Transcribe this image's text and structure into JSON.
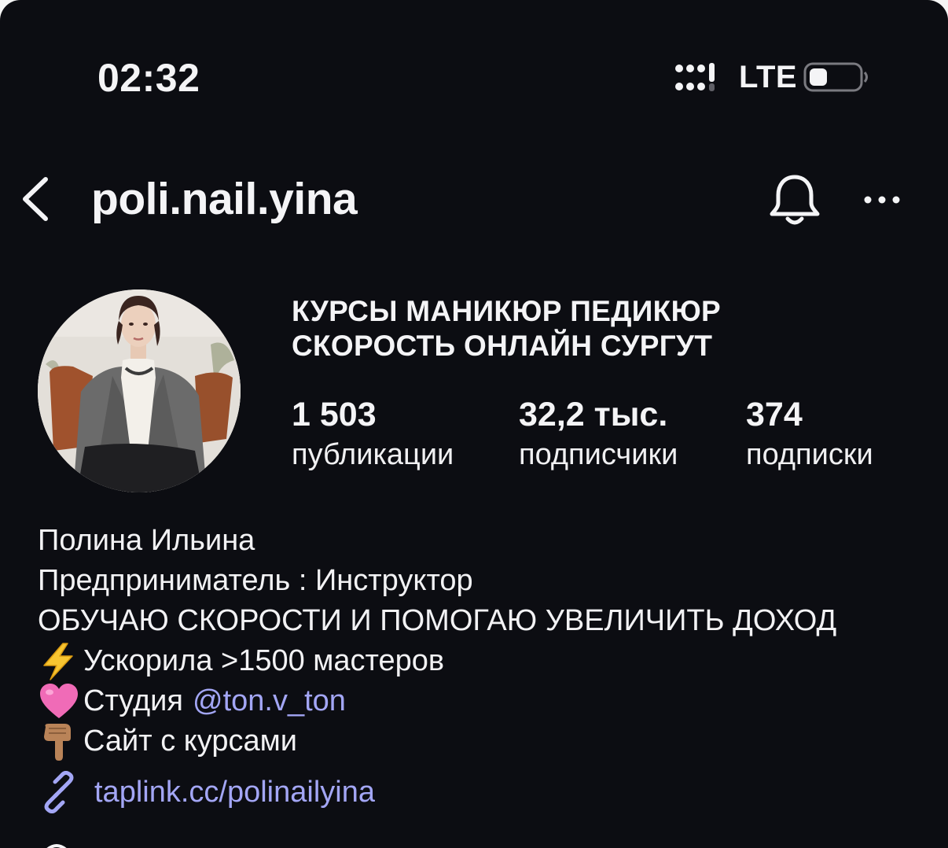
{
  "status_bar": {
    "time": "02:32",
    "network": "LTE",
    "icons": [
      "signal-icon",
      "battery-icon"
    ]
  },
  "header": {
    "username": "poli.nail.yina",
    "icons": [
      "back-icon",
      "bell-icon",
      "more-icon"
    ]
  },
  "profile": {
    "category_lines": [
      "КУРСЫ МАНИКЮР ПЕДИКЮР",
      "СКОРОСТЬ ОНЛАЙН СУРГУТ"
    ],
    "stats": [
      {
        "value": "1 503",
        "label": "публикации"
      },
      {
        "value": "32,2 тыс.",
        "label": "подписчики"
      },
      {
        "value": "374",
        "label": "подписки"
      }
    ]
  },
  "bio": {
    "name": "Полина Ильина",
    "role": "Предприниматель : Инструктор",
    "headline": "ОБУЧАЮ СКОРОСТИ И ПОМОГАЮ УВЕЛИЧИТЬ ДОХОД",
    "line_speed": "Ускорила >1500 мастеров",
    "line_studio": "Студия",
    "studio_mention": "@ton.v_ton",
    "line_site": "Сайт с курсами",
    "emojis": [
      "lightning-emoji",
      "pink-heart-emoji",
      "pointing-down-emoji"
    ],
    "link": "taplink.cc/polinailyina",
    "link_icon": "link-icon"
  },
  "colors": {
    "background": "#0c0d12",
    "text": "#f4f4f6",
    "link": "#a3a6f5",
    "secondary_icon": "#5f5f66"
  }
}
